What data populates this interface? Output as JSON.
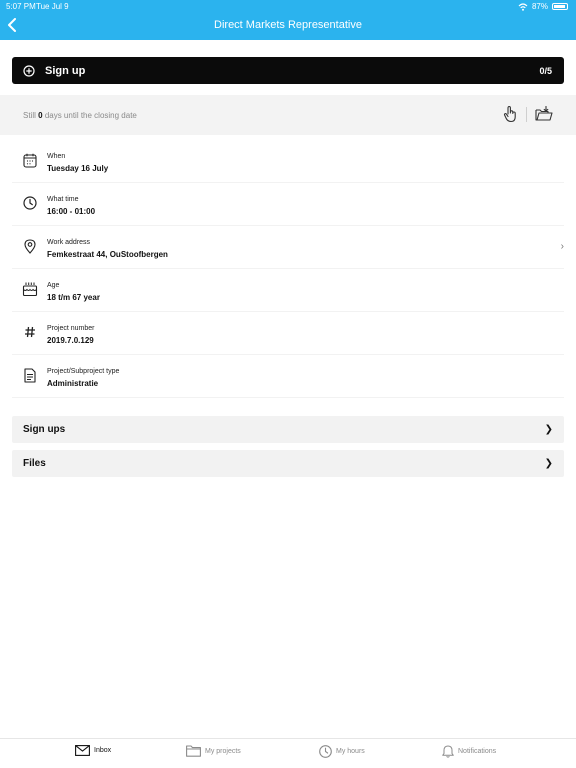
{
  "status_bar": {
    "time": "5:07 PM",
    "date": "Tue Jul 9",
    "battery": "87%"
  },
  "header": {
    "title": "Direct Markets Representative"
  },
  "signup": {
    "label": "Sign up",
    "count": "0/5"
  },
  "closing": {
    "prefix": "Still",
    "days": "0",
    "suffix": "days until the closing date"
  },
  "info_rows": [
    {
      "icon": "calendar-icon",
      "label": "When",
      "value": "Tuesday 16 July",
      "chevron": ""
    },
    {
      "icon": "clock-icon",
      "label": "What time",
      "value": "16:00 - 01:00",
      "chevron": ""
    },
    {
      "icon": "location-pin-icon",
      "label": "Work address",
      "value": "Femkestraat 44, OuStoofbergen",
      "chevron": "›"
    },
    {
      "icon": "birthday-cake-icon",
      "label": "Age",
      "value": "18 t/m 67 year",
      "chevron": ""
    },
    {
      "icon": "hashtag-icon",
      "label": "Project number",
      "value": "2019.7.0.129",
      "chevron": ""
    },
    {
      "icon": "document-icon",
      "label": "Project/Subproject type",
      "value": "Administratie",
      "chevron": ""
    }
  ],
  "sections": {
    "signups": "Sign ups",
    "files": "Files",
    "chevron": "❯"
  },
  "tabs": {
    "inbox": "Inbox",
    "projects": "My projects",
    "hours": "My hours",
    "notifications": "Notifications"
  },
  "colors": {
    "header_bg": "#2bb3ee",
    "signup_bg": "#0b0b0b",
    "band_bg": "#f3f3f3",
    "section_bg": "#f2f2f2"
  }
}
